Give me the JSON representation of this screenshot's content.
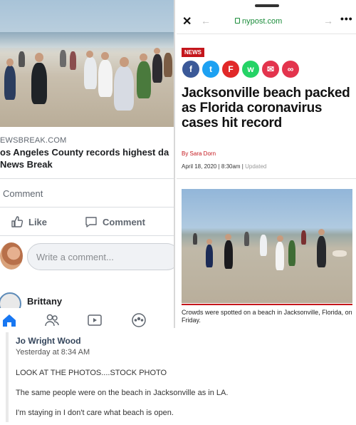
{
  "facebook": {
    "source": "EWSBREAK.COM",
    "headline": "os Angeles County records highest da",
    "site": "News Break",
    "comment_label": "Comment",
    "like_label": "Like",
    "comment_action_label": "Comment",
    "comment_placeholder": "Write a comment...",
    "commenter_name": "Brittany"
  },
  "nypost": {
    "url": "nypost.com",
    "tag": "NEWS",
    "headline": "Jacksonville beach packed as Florida coronavirus cases hit record",
    "byline": "By Sara Dorn",
    "date": "April 18, 2020 | 8:30am | ",
    "updated": "Updated",
    "caption": "Crowds were spotted on a beach in Jacksonville, Florida, on Friday.",
    "share_icons": [
      {
        "name": "facebook-share-icon",
        "glyph": "f",
        "color": "#3b5998"
      },
      {
        "name": "twitter-share-icon",
        "glyph": "t",
        "color": "#1da1f2"
      },
      {
        "name": "flipboard-share-icon",
        "glyph": "F",
        "color": "#e12828"
      },
      {
        "name": "whatsapp-share-icon",
        "glyph": "w",
        "color": "#25d366"
      },
      {
        "name": "email-share-icon",
        "glyph": "✉",
        "color": "#e3344d"
      },
      {
        "name": "link-share-icon",
        "glyph": "∞",
        "color": "#e3344d"
      }
    ]
  },
  "post_comment": {
    "author": "Jo Wright Wood",
    "timestamp": "Yesterday at 8:34 AM",
    "lines": [
      "LOOK AT THE PHOTOS....STOCK PHOTO",
      "The same people were on the beach in Jacksonville as in LA.",
      "I'm staying in I don't care what beach is open."
    ]
  }
}
